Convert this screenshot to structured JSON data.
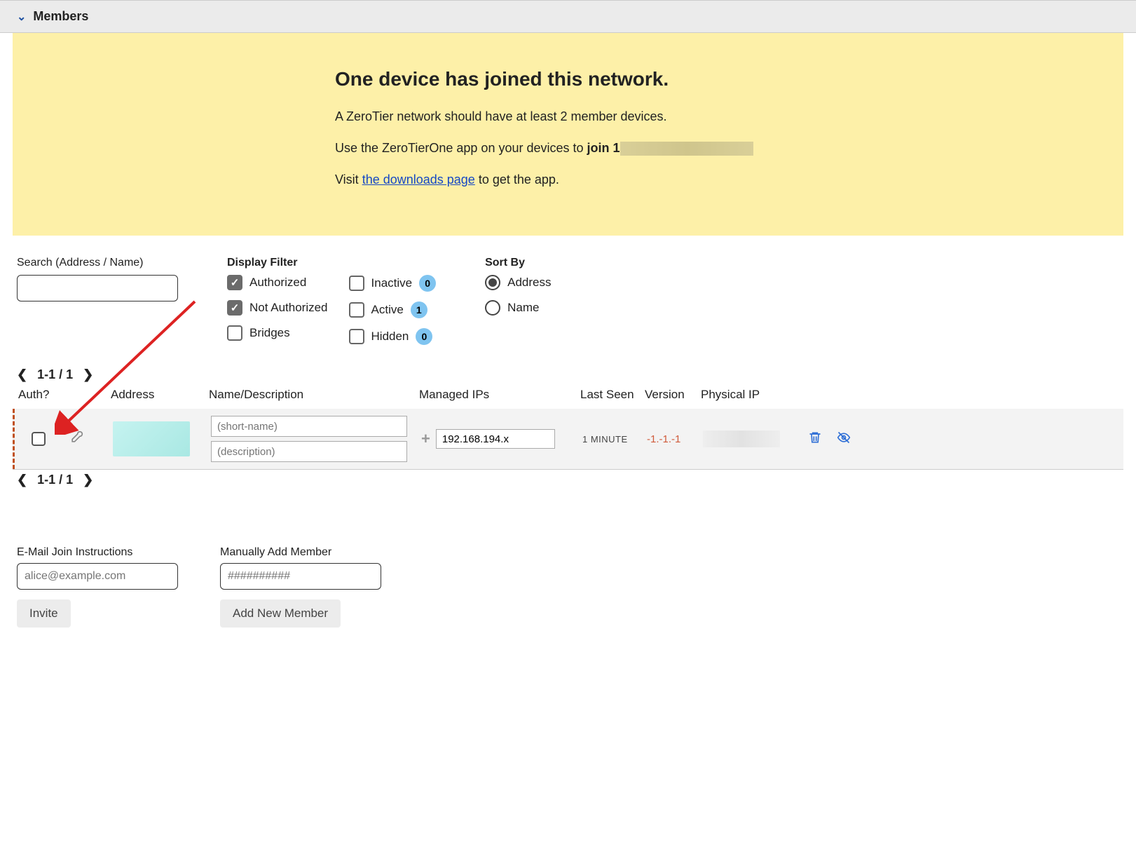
{
  "header": {
    "title": "Members"
  },
  "banner": {
    "heading": "One device has joined this network.",
    "line1": "A ZeroTier network should have at least 2 member devices.",
    "line2_prefix": "Use the ZeroTierOne app on your devices to ",
    "line2_join": "join 1",
    "line3_prefix": "Visit ",
    "line3_link": "the downloads page",
    "line3_suffix": " to get the app."
  },
  "search": {
    "label": "Search (Address / Name)"
  },
  "filter": {
    "label": "Display Filter",
    "authorized": "Authorized",
    "not_authorized": "Not Authorized",
    "bridges": "Bridges",
    "inactive": "Inactive",
    "active": "Active",
    "hidden": "Hidden",
    "count_inactive": "0",
    "count_active": "1",
    "count_hidden": "0"
  },
  "sort": {
    "label": "Sort By",
    "address": "Address",
    "name": "Name"
  },
  "pager": {
    "text": "1-1 / 1"
  },
  "columns": {
    "auth": "Auth?",
    "address": "Address",
    "name": "Name/Description",
    "ips": "Managed IPs",
    "seen": "Last Seen",
    "version": "Version",
    "physical": "Physical IP"
  },
  "row": {
    "shortname_placeholder": "(short-name)",
    "description_placeholder": "(description)",
    "ip": "192.168.194.x",
    "last_seen": "1 MINUTE",
    "version": "-1.-1.-1"
  },
  "forms": {
    "email_label": "E-Mail Join Instructions",
    "email_placeholder": "alice@example.com",
    "invite_button": "Invite",
    "manual_label": "Manually Add Member",
    "manual_placeholder": "##########",
    "add_button": "Add New Member"
  }
}
